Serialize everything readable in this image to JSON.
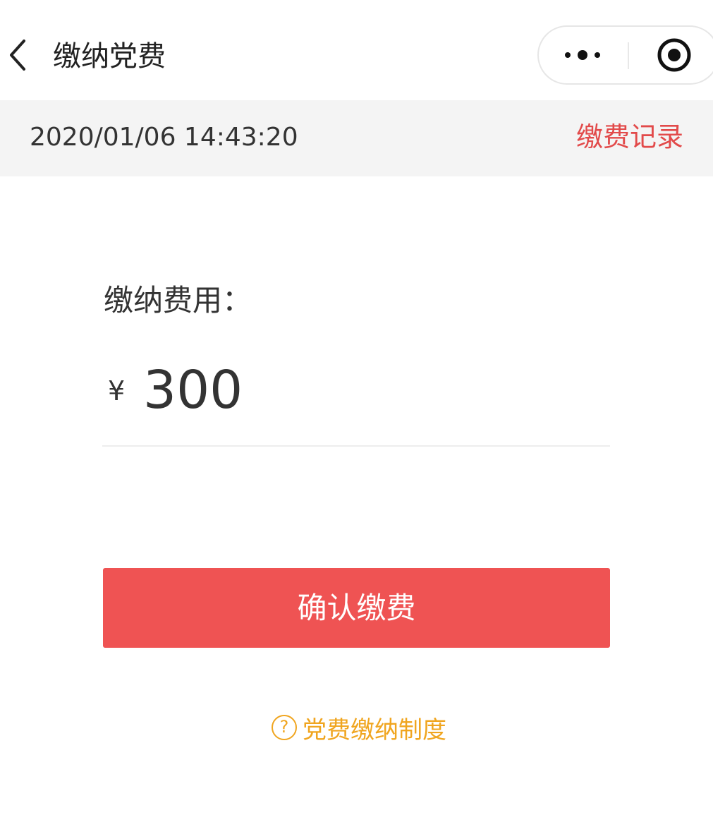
{
  "navbar": {
    "title": "缴纳党费"
  },
  "info_bar": {
    "datetime": "2020/01/06 14:43:20",
    "record_link": "缴费记录"
  },
  "payment": {
    "label": "缴纳费用：",
    "currency": "¥",
    "amount": "300"
  },
  "actions": {
    "confirm_label": "确认缴费",
    "policy_label": "党费缴纳制度"
  },
  "colors": {
    "accent_red": "#ef5353",
    "link_red": "#e24a4a",
    "policy_orange": "#f0a51f"
  }
}
